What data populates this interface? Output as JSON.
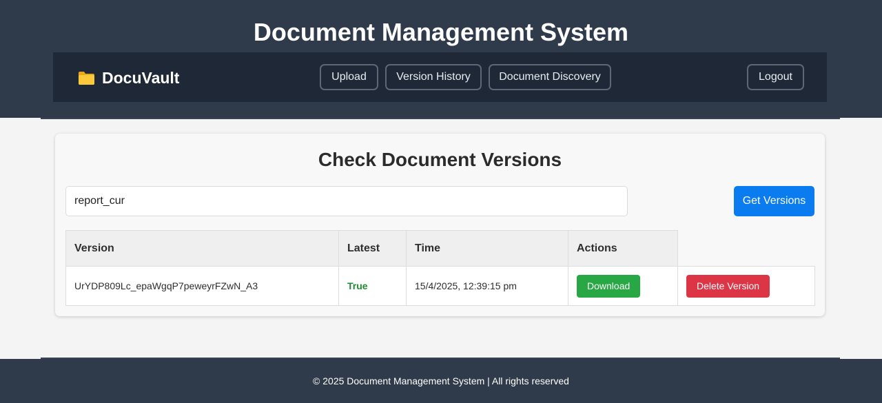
{
  "header": {
    "title": "Document Management System"
  },
  "nav": {
    "brand": "DocuVault",
    "brand_icon": "folder-icon",
    "upload_label": "Upload",
    "version_history_label": "Version History",
    "discovery_label": "Document Discovery",
    "logout_label": "Logout"
  },
  "card": {
    "title": "Check Document Versions",
    "input_value": "report_cur",
    "button_label": "Get Versions"
  },
  "table": {
    "headers": [
      "Version",
      "Latest",
      "Time",
      "Actions"
    ],
    "rows": [
      {
        "version": "UrYDP809Lc_epaWgqP7peweyrFZwN_A3",
        "latest": "True",
        "time": "15/4/2025, 12:39:15 pm",
        "download_label": "Download",
        "delete_label": "Delete Version"
      }
    ]
  },
  "footer": {
    "text": "© 2025 Document Management System | All rights reserved"
  },
  "colors": {
    "header_bg": "#2f3b4a",
    "navbar_bg": "#1f2836",
    "primary": "#0a7cf0",
    "success": "#27a845",
    "danger": "#dc3545",
    "latest_true": "#1e8a32"
  }
}
